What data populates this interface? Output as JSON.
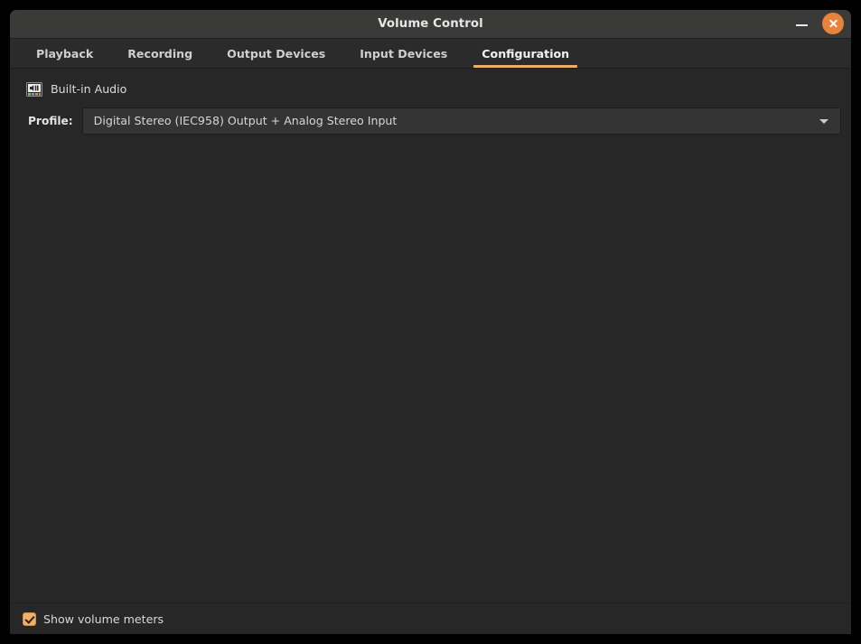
{
  "window": {
    "title": "Volume Control",
    "minimize_label": "Minimize",
    "close_label": "Close",
    "accent_color": "#e9823b",
    "titlebar_color": "#3a3a39",
    "content_color": "#272727"
  },
  "tabs": [
    {
      "label": "Playback",
      "active": false
    },
    {
      "label": "Recording",
      "active": false
    },
    {
      "label": "Output Devices",
      "active": false
    },
    {
      "label": "Input Devices",
      "active": false
    },
    {
      "label": "Configuration",
      "active": true
    }
  ],
  "main": {
    "device": {
      "icon": "audio-card-icon",
      "name": "Built-in Audio"
    },
    "profile": {
      "label": "Profile:",
      "value": "Digital Stereo (IEC958) Output + Analog Stereo Input",
      "arrow_icon": "chevron-down-icon"
    }
  },
  "footer": {
    "show_volume_meters": {
      "label": "Show volume meters",
      "checked": true,
      "color": "#f0b069"
    }
  }
}
